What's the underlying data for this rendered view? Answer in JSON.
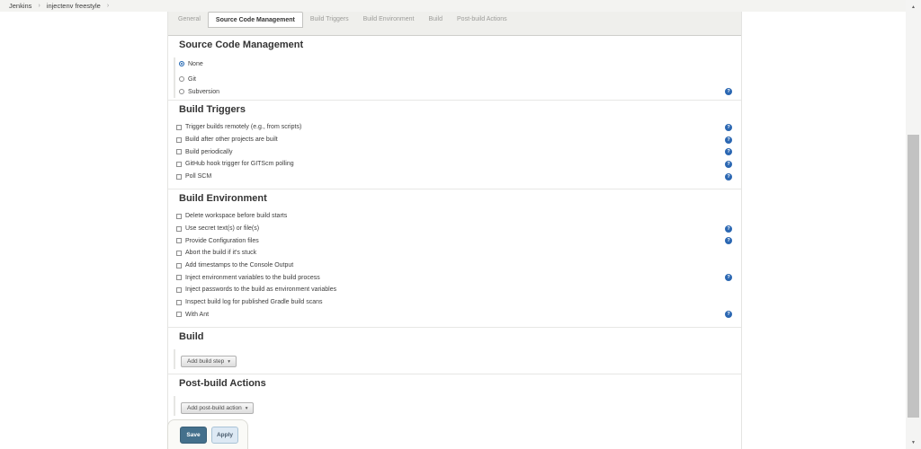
{
  "breadcrumb": {
    "separator": "›",
    "items": [
      "Jenkins",
      "injectenv freestyle"
    ]
  },
  "tabs": [
    {
      "label": "General",
      "active": false
    },
    {
      "label": "Source Code Management",
      "active": true
    },
    {
      "label": "Build Triggers",
      "active": false
    },
    {
      "label": "Build Environment",
      "active": false
    },
    {
      "label": "Build",
      "active": false
    },
    {
      "label": "Post-build Actions",
      "active": false
    }
  ],
  "scm": {
    "title": "Source Code Management",
    "options": [
      {
        "label": "None",
        "selected": true,
        "help": false
      },
      {
        "label": "Git",
        "selected": false,
        "help": false
      },
      {
        "label": "Subversion",
        "selected": false,
        "help": true
      }
    ]
  },
  "triggers": {
    "title": "Build Triggers",
    "options": [
      {
        "label": "Trigger builds remotely (e.g., from scripts)",
        "checked": false,
        "help": true
      },
      {
        "label": "Build after other projects are built",
        "checked": false,
        "help": true
      },
      {
        "label": "Build periodically",
        "checked": false,
        "help": true
      },
      {
        "label": "GitHub hook trigger for GITScm polling",
        "checked": false,
        "help": true
      },
      {
        "label": "Poll SCM",
        "checked": false,
        "help": true
      }
    ]
  },
  "environment": {
    "title": "Build Environment",
    "options": [
      {
        "label": "Delete workspace before build starts",
        "checked": false,
        "help": false
      },
      {
        "label": "Use secret text(s) or file(s)",
        "checked": false,
        "help": true
      },
      {
        "label": "Provide Configuration files",
        "checked": false,
        "help": true
      },
      {
        "label": "Abort the build if it's stuck",
        "checked": false,
        "help": false
      },
      {
        "label": "Add timestamps to the Console Output",
        "checked": false,
        "help": false
      },
      {
        "label": "Inject environment variables to the build process",
        "checked": false,
        "help": true
      },
      {
        "label": "Inject passwords to the build as environment variables",
        "checked": false,
        "help": false
      },
      {
        "label": "Inspect build log for published Gradle build scans",
        "checked": false,
        "help": false
      },
      {
        "label": "With Ant",
        "checked": false,
        "help": true
      }
    ]
  },
  "build": {
    "title": "Build",
    "add_button": "Add build step"
  },
  "post_build": {
    "title": "Post-build Actions",
    "add_button": "Add post-build action"
  },
  "footer": {
    "save": "Save",
    "apply": "Apply"
  },
  "icons": {
    "help": "?",
    "dropdown_caret": "▾",
    "scroll_up": "▲",
    "scroll_down": "▼"
  },
  "colors": {
    "accent_blue": "#2166b2",
    "help_icon": "#2b67b2",
    "save_button": "#44708c",
    "apply_button_bg": "#dde9f4",
    "tab_strip_bg": "#efefec",
    "breadcrumb_bg": "#f3f3f1"
  }
}
